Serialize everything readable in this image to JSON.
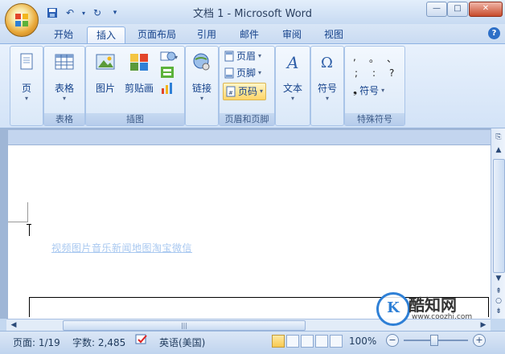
{
  "window": {
    "title": "文档 1 - Microsoft Word",
    "min_label": "—",
    "max_label": "□",
    "close_label": "✕"
  },
  "qat": {
    "save_icon": "save-icon",
    "undo_icon": "undo-icon",
    "redo_icon": "redo-icon",
    "customize_icon": "chevron-down-icon"
  },
  "tabs": [
    {
      "label": "开始",
      "active": false
    },
    {
      "label": "插入",
      "active": true
    },
    {
      "label": "页面布局",
      "active": false
    },
    {
      "label": "引用",
      "active": false
    },
    {
      "label": "邮件",
      "active": false
    },
    {
      "label": "审阅",
      "active": false
    },
    {
      "label": "视图",
      "active": false
    }
  ],
  "ribbon": {
    "pages": {
      "button": "页"
    },
    "tables": {
      "button": "表格",
      "group": "表格"
    },
    "illustrations": {
      "picture": "图片",
      "clipart": "剪贴画",
      "group": "插图"
    },
    "links": {
      "button": "链接"
    },
    "header_footer": {
      "header": "页眉",
      "footer": "页脚",
      "page_number": "页码",
      "group": "页眉和页脚"
    },
    "text": {
      "button": "文本"
    },
    "symbols": {
      "button": "符号"
    },
    "special": {
      "symbols": [
        ",",
        "。",
        "、",
        ";",
        ":",
        "?"
      ],
      "button": "符号",
      "group": "特殊符号"
    }
  },
  "document": {
    "body_text": "视频图片音乐新闻地图淘宝微信"
  },
  "hscroll_grip": "|||",
  "statusbar": {
    "page": "页面: 1/19",
    "words": "字数: 2,485",
    "language": "英语(美国)",
    "zoom": "100%",
    "zoom_minus": "−",
    "zoom_plus": "+"
  },
  "watermark": {
    "logo_letter": "K",
    "name": "酷知网",
    "url": "www.coozhi.com"
  },
  "colors": {
    "accent": "#15428b",
    "ribbon_bg": "#d3e3f7",
    "highlight": "#ffd568"
  }
}
